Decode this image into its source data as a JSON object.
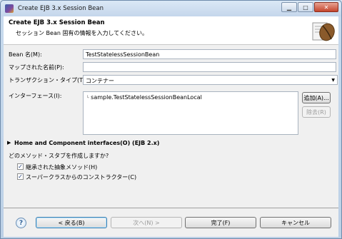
{
  "window": {
    "title": "Create EJB 3.x Session Bean",
    "buttons": {
      "minimize": "▁",
      "maximize": "□",
      "close": "✕"
    }
  },
  "banner": {
    "title": "Create EJB 3.x Session Bean",
    "description": "セッション Bean 固有の情報を入力してください。"
  },
  "form": {
    "bean_name_label": "Bean 名(M):",
    "bean_name_value": "TestStatelessSessionBean",
    "mapped_name_label": "マップされた名前(P):",
    "mapped_name_value": "",
    "transaction_type_label": "トランザクション・タイプ(T):",
    "transaction_type_value": "コンテナー",
    "interfaces_label": "インターフェース(I):",
    "interfaces": [
      "sample.TestStatelessSessionBeanLocal"
    ],
    "add_button": "追加(A)...",
    "remove_button": "除去(R)",
    "home_section_label": "Home and Component interfaces(O) (EJB 2.x)",
    "stubs_question": "どのメソッド・スタブを作成しますか?",
    "checkbox_inherited_label": "継承された抽象メソッド(H)",
    "checkbox_inherited_checked": true,
    "checkbox_constructors_label": "スーパークラスからのコンストラクター(C)",
    "checkbox_constructors_checked": true
  },
  "footer": {
    "help": "?",
    "back_button": "< 戻る(B)",
    "next_button": "次へ(N) >",
    "finish_button": "完了(F)",
    "cancel_button": "キャンセル"
  }
}
